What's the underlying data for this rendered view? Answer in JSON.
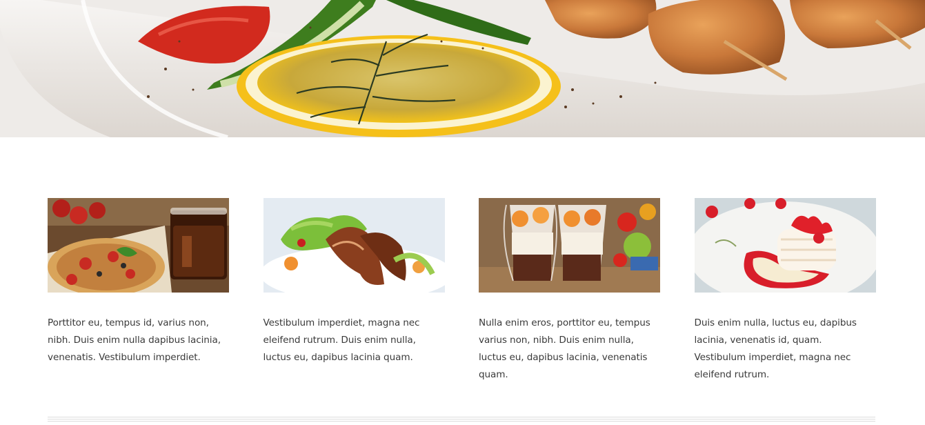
{
  "hero": {
    "image": "grilled-kebab-plate-image"
  },
  "features": [
    {
      "image": "pizza-and-cola-image",
      "text": "Porttitor eu, tempus id, varius non, nibh. Duis enim nulla dapibus lacinia, venenatis. Vestibulum imperdiet."
    },
    {
      "image": "fish-salad-image",
      "text": "Vestibulum imperdiet, magna nec eleifend rutrum. Duis enim nulla, luctus eu, dapibus lacinia quam."
    },
    {
      "image": "fruit-parfait-image",
      "text": "Nulla enim eros, porttitor eu, tempus varius non, nibh. Duis enim nulla, luctus eu, dapibus lacinia, venenatis quam."
    },
    {
      "image": "strawberry-cake-image",
      "text": "Duis enim nulla, luctus eu, dapibus lacinia, venenatis id, quam. Vestibulum imperdiet, magna nec eleifend rutrum."
    }
  ]
}
